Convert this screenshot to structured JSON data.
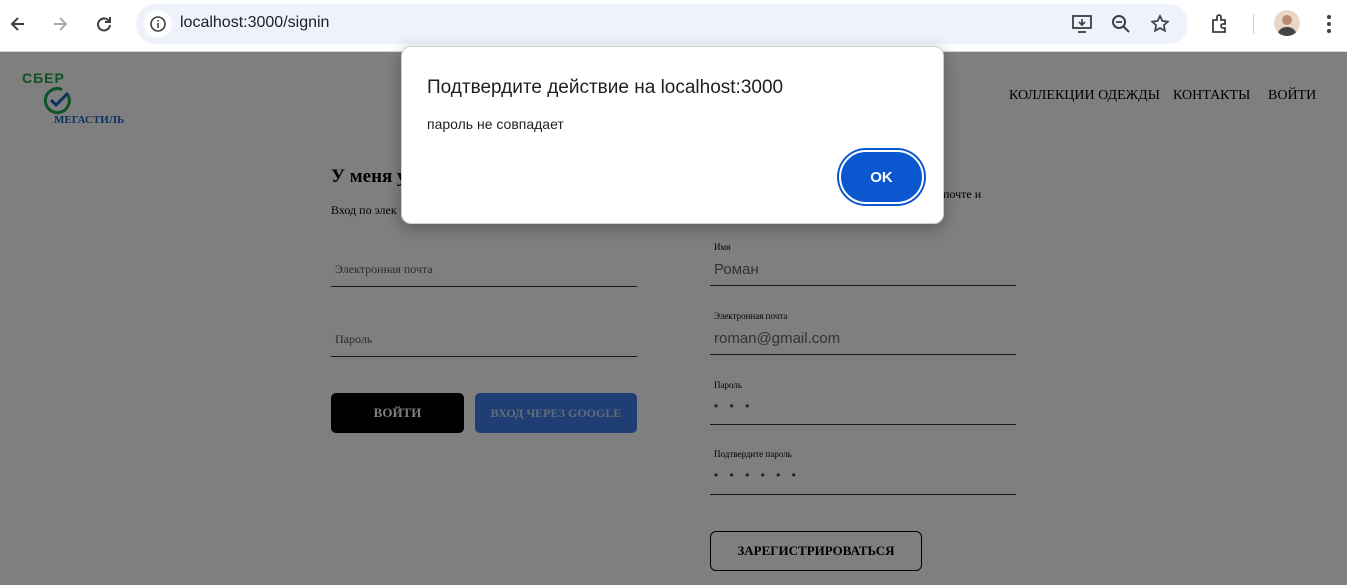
{
  "browser": {
    "url": "localhost:3000/signin"
  },
  "site": {
    "logo_top": "СБЕР",
    "logo_bottom": "МЕГАСТИЛЬ",
    "nav": [
      "КОЛЛЕКЦИИ ОДЕЖДЫ",
      "КОНТАКТЫ",
      "ВОЙТИ"
    ]
  },
  "login": {
    "title": "У меня у",
    "subtitle": "Вход по элек",
    "email_placeholder": "Электронная почта",
    "password_placeholder": "Пароль",
    "login_button": "ВОЙТИ",
    "google_button": "ВХОД ЧЕРЕЗ GOOGLE"
  },
  "register": {
    "subtitle_fragment": "почте и",
    "name_label": "Имя",
    "name_value": "Роман",
    "email_label": "Электронная почта",
    "email_value": "roman@gmail.com",
    "password_label": "Пароль",
    "password_value": "• • •",
    "confirm_label": "Подтвердите пароль",
    "confirm_value": "• • • • • •",
    "register_button": "ЗАРЕГИСТРИРОВАТЬСЯ"
  },
  "dialog": {
    "title": "Подтвердите действие на localhost:3000",
    "message": "пароль не совпадает",
    "ok_button": "OK"
  },
  "colors": {
    "accent": "#0b57d0",
    "google_button": "#3f7de6",
    "logo_green": "#1aa64a",
    "logo_blue": "#1565c0"
  }
}
